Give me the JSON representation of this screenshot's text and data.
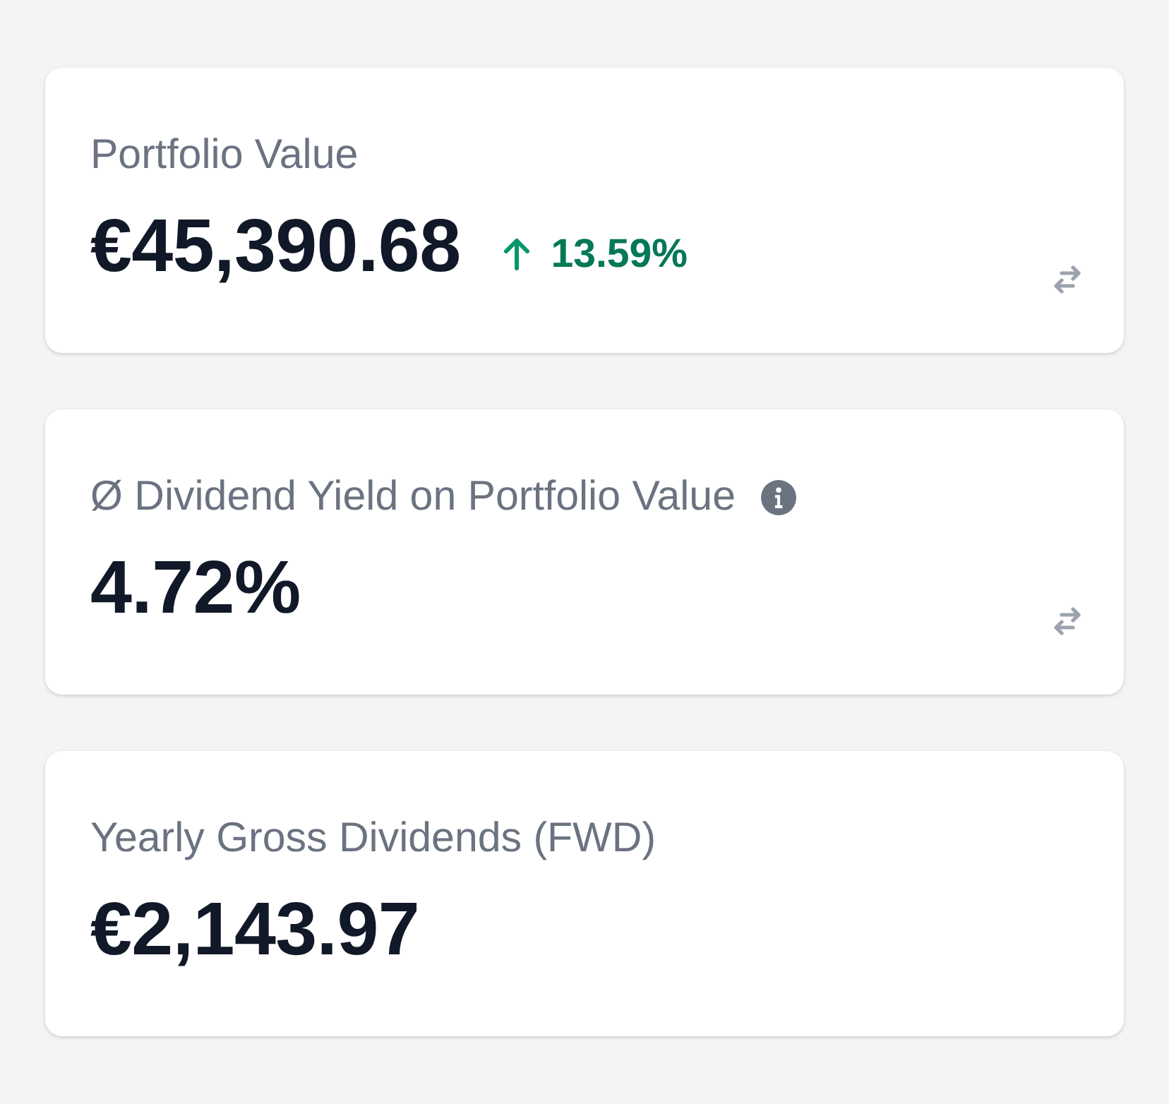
{
  "cards": [
    {
      "label": "Portfolio Value",
      "info": false,
      "value": "€45,390.68",
      "change": {
        "kind": "up",
        "text": "13.59%"
      },
      "toggle": true
    },
    {
      "label": "Ø Dividend Yield on Portfolio Value",
      "info": true,
      "value": "4.72%",
      "toggle": true
    },
    {
      "label": "Yearly Gross Dividends (FWD)",
      "info": false,
      "value": "€2,143.97",
      "toggle": false
    }
  ]
}
